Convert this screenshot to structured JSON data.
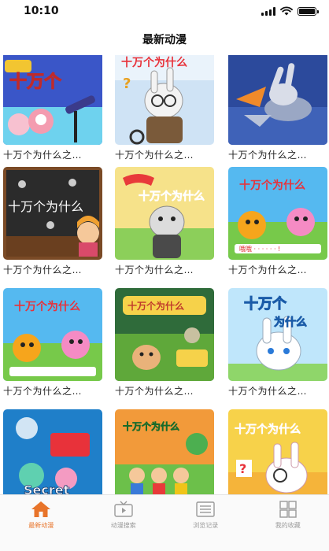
{
  "status_bar": {
    "time": "10:10"
  },
  "nav": {
    "title": "最新动漫"
  },
  "cards": [
    {
      "title": "十万个为什么之…"
    },
    {
      "title": "十万个为什么之…"
    },
    {
      "title": "十万个为什么之…"
    },
    {
      "title": "十万个为什么之…"
    },
    {
      "title": "十万个为什么之…"
    },
    {
      "title": "十万个为什么之…"
    },
    {
      "title": "十万个为什么之…"
    },
    {
      "title": "十万个为什么之…"
    },
    {
      "title": "十万个为什么之…"
    },
    {
      "title": ""
    },
    {
      "title": ""
    },
    {
      "title": ""
    }
  ],
  "thumb_text": {
    "t3": "十万个为什么",
    "t4": "十万个为什么",
    "t8": "十万个为什么",
    "t9": "十万个",
    "t9b": "为什么",
    "t10": "Secret",
    "t11": "十万个为什么",
    "t12": "十万个为什么"
  },
  "tabs": [
    {
      "label": "最新动漫",
      "icon": "home-icon",
      "active": true
    },
    {
      "label": "动漫搜索",
      "icon": "tv-search-icon",
      "active": false
    },
    {
      "label": "浏览记录",
      "icon": "history-list-icon",
      "active": false
    },
    {
      "label": "我的收藏",
      "icon": "favorites-grid-icon",
      "active": false
    }
  ],
  "colors": {
    "accent": "#e8742a",
    "inactive": "#9a9a9a"
  }
}
